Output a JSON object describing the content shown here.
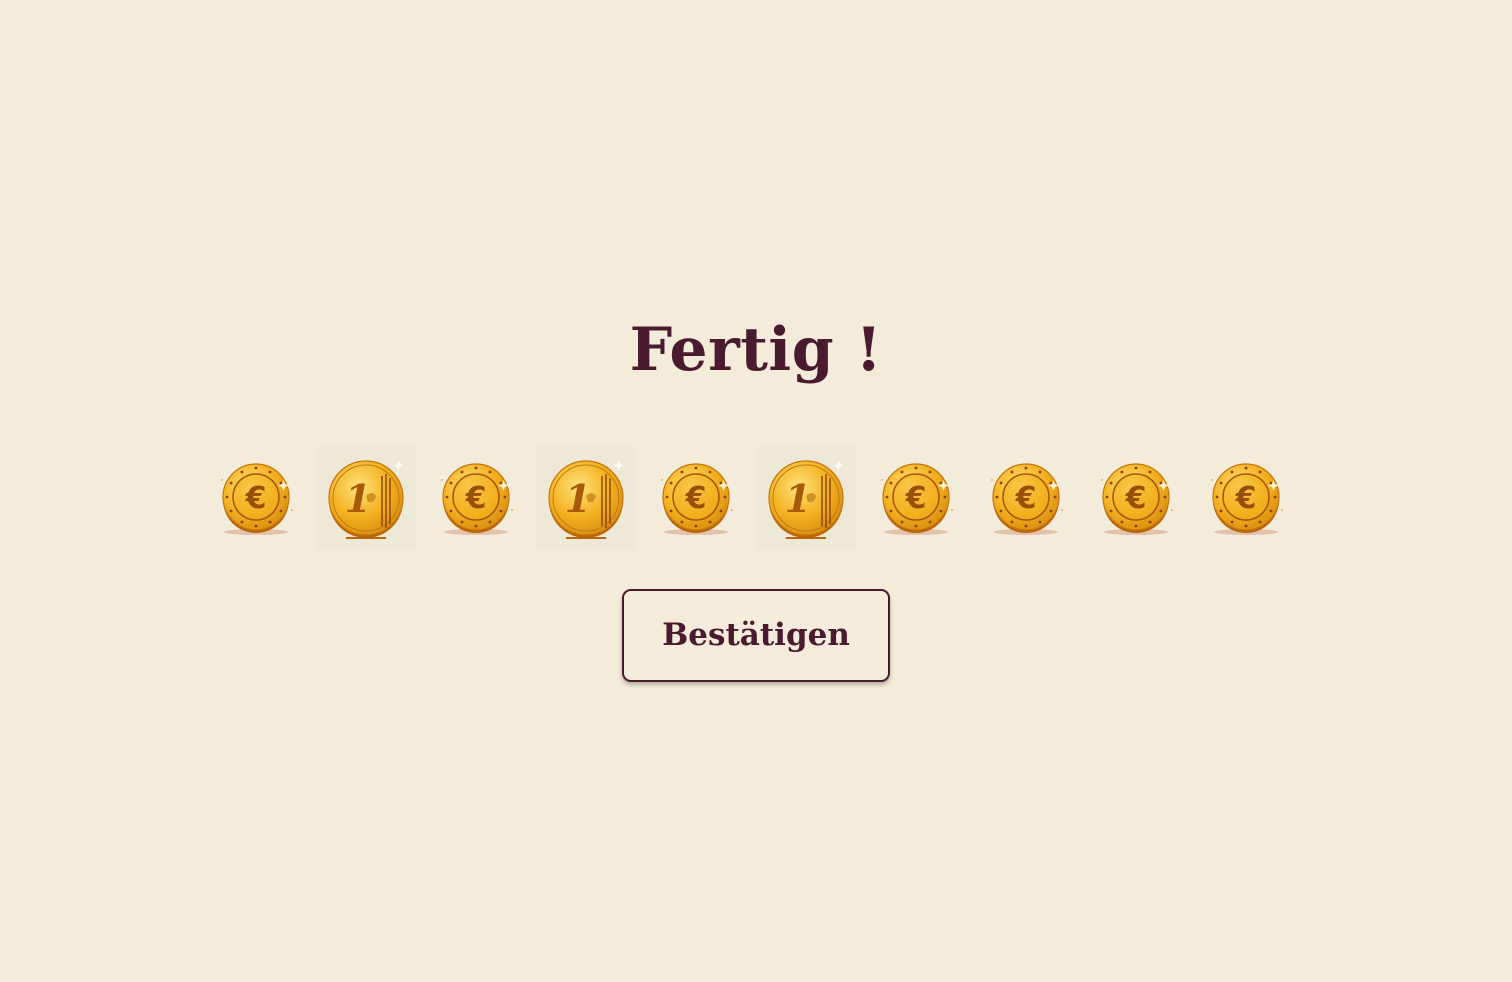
{
  "title": "Fertig !",
  "coins": [
    {
      "type": "euro-symbol",
      "symbol": "€",
      "icon": "euro-coin-icon"
    },
    {
      "type": "one-euro",
      "symbol": "1",
      "icon": "one-euro-coin-icon"
    },
    {
      "type": "euro-symbol",
      "symbol": "€",
      "icon": "euro-coin-icon"
    },
    {
      "type": "one-euro",
      "symbol": "1",
      "icon": "one-euro-coin-icon"
    },
    {
      "type": "euro-symbol",
      "symbol": "€",
      "icon": "euro-coin-icon"
    },
    {
      "type": "one-euro",
      "symbol": "1",
      "icon": "one-euro-coin-icon"
    },
    {
      "type": "euro-symbol",
      "symbol": "€",
      "icon": "euro-coin-icon"
    },
    {
      "type": "euro-symbol",
      "symbol": "€",
      "icon": "euro-coin-icon"
    },
    {
      "type": "euro-symbol",
      "symbol": "€",
      "icon": "euro-coin-icon"
    },
    {
      "type": "euro-symbol",
      "symbol": "€",
      "icon": "euro-coin-icon"
    }
  ],
  "confirm_button": {
    "label": "Bestätigen"
  },
  "colors": {
    "background": "#f3ecdb",
    "accent": "#4a1a2e",
    "coin_gold": "#f2b01e",
    "coin_dark": "#c8740c"
  }
}
